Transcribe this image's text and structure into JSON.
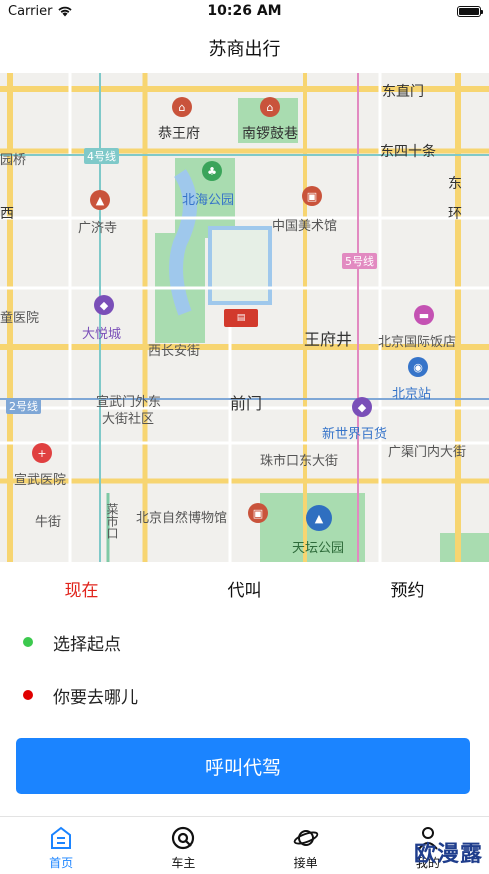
{
  "status_bar": {
    "carrier": "Carrier",
    "time": "10:26 AM"
  },
  "nav": {
    "title": "苏商出行"
  },
  "map": {
    "labels": [
      "东直门",
      "恭王府",
      "南锣鼓巷",
      "东四十条",
      "园桥",
      "4号线",
      "北海公园",
      "东",
      "西",
      "广济寺",
      "中国美术馆",
      "5号线",
      "环",
      "大悦城",
      "童医院",
      "王府井",
      "北京国际饭店",
      "西长安街",
      "北京站",
      "2号线",
      "宣武门外东",
      "大街社区",
      "前门",
      "新世界百货",
      "珠市口东大街",
      "广渠门内大街",
      "宣武医院",
      "牛街",
      "北京自然博物馆",
      "天坛公园",
      "菜市口"
    ]
  },
  "modes": [
    "现在",
    "代叫",
    "预约"
  ],
  "origin": {
    "label": "选择起点",
    "color": "#3cc94e"
  },
  "destination": {
    "label": "你要去哪儿",
    "color": "#e00000"
  },
  "call_button": {
    "label": "呼叫代驾"
  },
  "tab_bar": {
    "items": [
      {
        "label": "首页",
        "icon": "home-icon"
      },
      {
        "label": "车主",
        "icon": "steering-wheel-icon"
      },
      {
        "label": "接单",
        "icon": "planet-icon"
      },
      {
        "label": "我的",
        "icon": "person-icon"
      }
    ]
  },
  "watermark": "欧漫露",
  "colors": {
    "accent": "#1b84ff",
    "active_mode": "#e1231b"
  }
}
